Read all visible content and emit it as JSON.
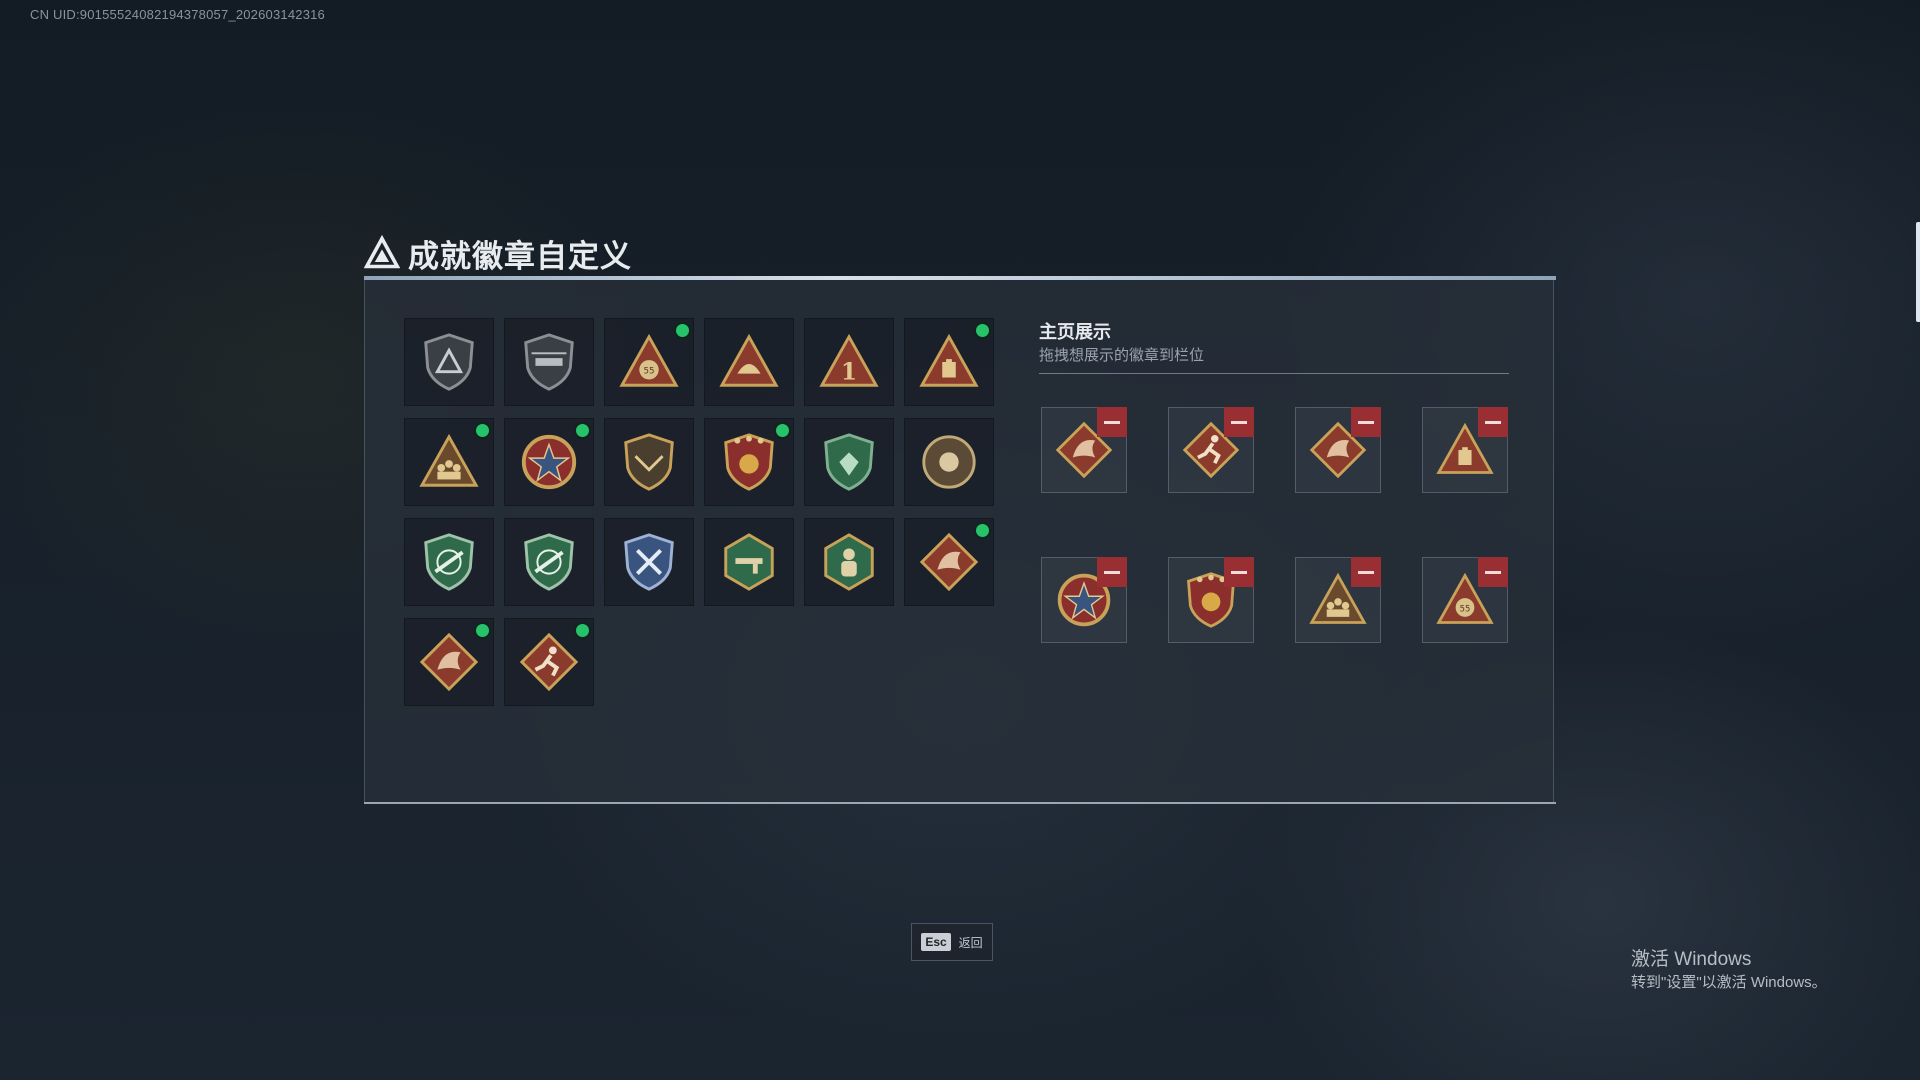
{
  "uid_text": "CN UID:9015552408219437805​7_202603142316",
  "page_title": "成就徽章自定义",
  "showcase": {
    "title": "主页展示",
    "subtitle": "拖拽想展示的徽章到栏位"
  },
  "esc": {
    "key": "Esc",
    "label": "返回"
  },
  "watermark": {
    "line1": "激活 Windows",
    "line2": "转到\"设置\"以激活 Windows。"
  },
  "owned_badges": [
    {
      "icon": "delta-shield-badge-icon",
      "new": false
    },
    {
      "icon": "helicopter-shield-badge-icon",
      "new": false
    },
    {
      "icon": "money-bag-55-triangle-badge-icon",
      "new": true
    },
    {
      "icon": "helmet-triangle-badge-icon",
      "new": false
    },
    {
      "icon": "number-one-triangle-badge-icon",
      "new": false
    },
    {
      "icon": "battery-triangle-badge-icon",
      "new": true
    },
    {
      "icon": "squad-triangle-badge-icon",
      "new": true
    },
    {
      "icon": "star-wreath-badge-icon",
      "new": true
    },
    {
      "icon": "wings-shield-badge-icon",
      "new": false
    },
    {
      "icon": "stars-crest-badge-icon",
      "new": true
    },
    {
      "icon": "gem-green-shield-badge-icon",
      "new": false
    },
    {
      "icon": "gear-coin-badge-icon",
      "new": false
    },
    {
      "icon": "rifle-green-shield-badge-icon",
      "new": false
    },
    {
      "icon": "rifle-green-shield-2-badge-icon",
      "new": false
    },
    {
      "icon": "tools-blue-shield-badge-icon",
      "new": false
    },
    {
      "icon": "gun-hexagon-badge-icon",
      "new": false
    },
    {
      "icon": "soldier-hexagon-badge-icon",
      "new": false
    },
    {
      "icon": "dragon-diamond-badge-icon",
      "new": true
    },
    {
      "icon": "dragon-diamond-2-badge-icon",
      "new": true
    },
    {
      "icon": "runner-diamond-badge-icon",
      "new": true
    }
  ],
  "showcase_slots": [
    {
      "icon": "dragon-diamond-badge-icon"
    },
    {
      "icon": "runner-diamond-badge-icon"
    },
    {
      "icon": "dragon-diamond-2-badge-icon"
    },
    {
      "icon": "battery-triangle-badge-icon"
    },
    {
      "icon": "star-wreath-badge-icon"
    },
    {
      "icon": "stars-crest-badge-icon"
    },
    {
      "icon": "squad-triangle-badge-icon"
    },
    {
      "icon": "money-bag-55-triangle-badge-icon"
    }
  ],
  "colors": {
    "new_dot": "#27c36b",
    "remove_button": "#9a2f33",
    "gold": "#c9a25a",
    "bronze_red": "#8a3b2c",
    "green_badge": "#2f6a4a",
    "blue_badge": "#3a5480"
  }
}
